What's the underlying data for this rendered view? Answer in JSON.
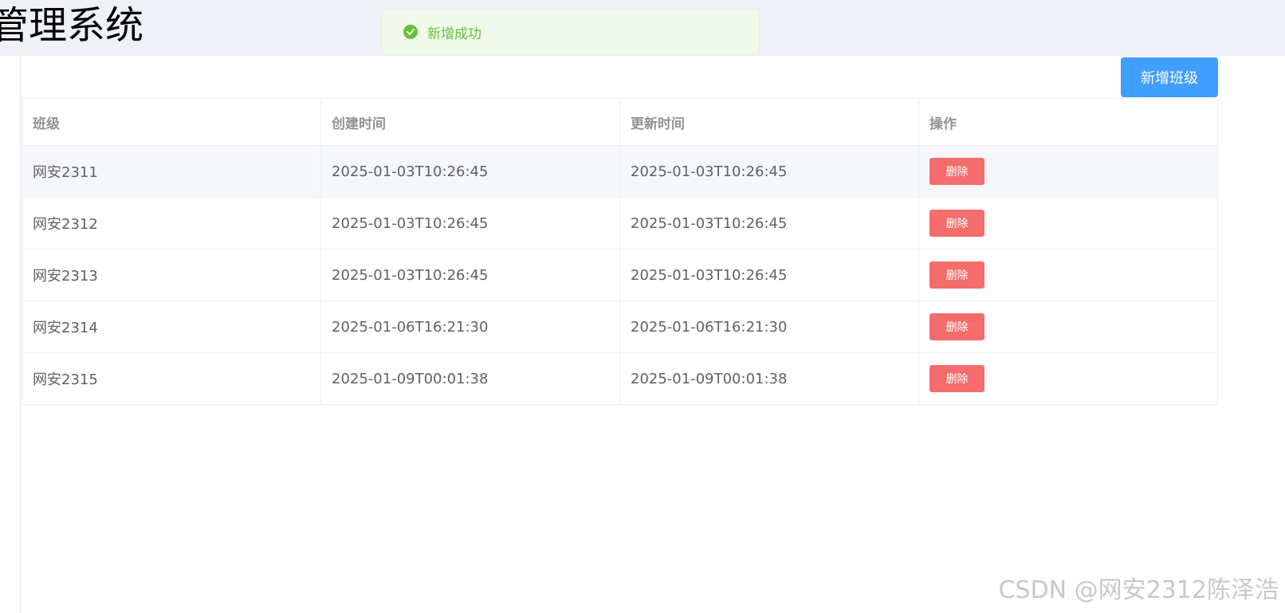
{
  "app": {
    "title": "管理系统"
  },
  "toast": {
    "message": "新增成功",
    "icon": "check-circle-icon",
    "color": "#67c23a"
  },
  "toolbar": {
    "add_label": "新增班级",
    "add_color": "#409eff"
  },
  "table": {
    "headers": [
      "班级",
      "创建时间",
      "更新时间",
      "操作"
    ],
    "rows": [
      {
        "name": "网安2311",
        "created": "2025-01-03T10:26:45",
        "updated": "2025-01-03T10:26:45",
        "action": "删除"
      },
      {
        "name": "网安2312",
        "created": "2025-01-03T10:26:45",
        "updated": "2025-01-03T10:26:45",
        "action": "删除"
      },
      {
        "name": "网安2313",
        "created": "2025-01-03T10:26:45",
        "updated": "2025-01-03T10:26:45",
        "action": "删除"
      },
      {
        "name": "网安2314",
        "created": "2025-01-06T16:21:30",
        "updated": "2025-01-06T16:21:30",
        "action": "删除"
      },
      {
        "name": "网安2315",
        "created": "2025-01-09T00:01:38",
        "updated": "2025-01-09T00:01:38",
        "action": "删除"
      }
    ],
    "delete_color": "#f56c6c"
  },
  "watermark": {
    "text": "CSDN @网安2312陈泽浩"
  }
}
